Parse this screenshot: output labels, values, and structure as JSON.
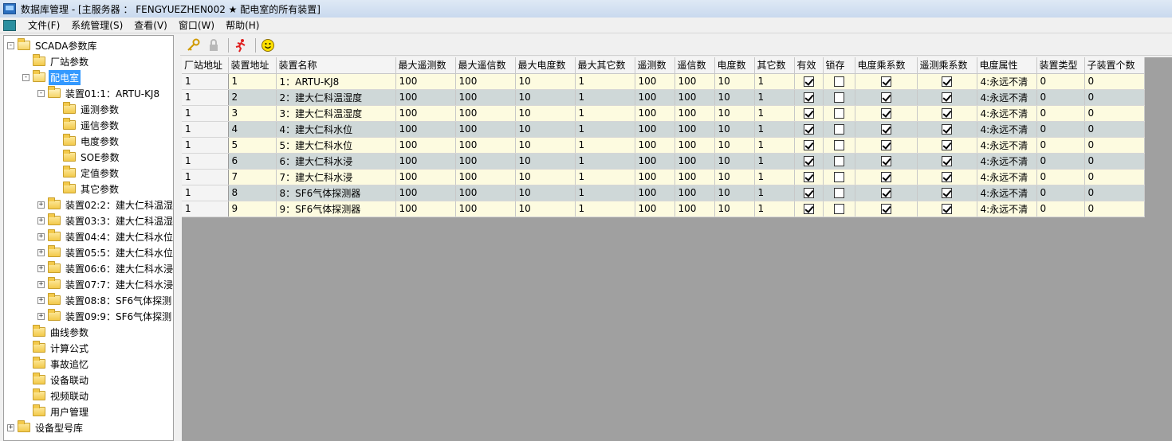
{
  "window": {
    "title": "数据库管理 - [主服务器 ： FENGYUEZHEN002 ★ 配电室的所有装置]"
  },
  "menu": [
    "文件(F)",
    "系统管理(S)",
    "查看(V)",
    "窗口(W)",
    "帮助(H)"
  ],
  "toolbar": {
    "icons": [
      "key-icon",
      "lock-icon",
      "running-man-icon",
      "smiley-icon"
    ]
  },
  "tree": [
    {
      "label": "SCADA参数库",
      "level": 0,
      "expander": "−",
      "open": true
    },
    {
      "label": "厂站参数",
      "level": 1
    },
    {
      "label": "配电室",
      "level": 1,
      "expander": "−",
      "open": true,
      "selected": true
    },
    {
      "label": "装置01:1：ARTU-KJ8",
      "level": 2,
      "expander": "−",
      "open": true
    },
    {
      "label": "遥测参数",
      "level": 3
    },
    {
      "label": "遥信参数",
      "level": 3
    },
    {
      "label": "电度参数",
      "level": 3
    },
    {
      "label": "SOE参数",
      "level": 3
    },
    {
      "label": "定值参数",
      "level": 3
    },
    {
      "label": "其它参数",
      "level": 3
    },
    {
      "label": "装置02:2：建大仁科温湿",
      "level": 2,
      "expander": "+"
    },
    {
      "label": "装置03:3：建大仁科温湿",
      "level": 2,
      "expander": "+"
    },
    {
      "label": "装置04:4：建大仁科水位",
      "level": 2,
      "expander": "+"
    },
    {
      "label": "装置05:5：建大仁科水位",
      "level": 2,
      "expander": "+"
    },
    {
      "label": "装置06:6：建大仁科水浸",
      "level": 2,
      "expander": "+"
    },
    {
      "label": "装置07:7：建大仁科水浸",
      "level": 2,
      "expander": "+"
    },
    {
      "label": "装置08:8：SF6气体探测",
      "level": 2,
      "expander": "+"
    },
    {
      "label": "装置09:9：SF6气体探测",
      "level": 2,
      "expander": "+"
    },
    {
      "label": "曲线参数",
      "level": 1
    },
    {
      "label": "计算公式",
      "level": 1
    },
    {
      "label": "事故追忆",
      "level": 1
    },
    {
      "label": "设备联动",
      "level": 1
    },
    {
      "label": "视频联动",
      "level": 1
    },
    {
      "label": "用户管理",
      "level": 1
    },
    {
      "label": "设备型号库",
      "level": 0,
      "expander": "+"
    }
  ],
  "grid": {
    "columns": [
      "厂站地址",
      "装置地址",
      "装置名称",
      "最大遥测数",
      "最大遥信数",
      "最大电度数",
      "最大其它数",
      "遥测数",
      "遥信数",
      "电度数",
      "其它数",
      "有效",
      "锁存",
      "电度乘系数",
      "遥测乘系数",
      "电度属性",
      "装置类型",
      "子装置个数"
    ],
    "rows": [
      [
        "1",
        "1",
        "1：ARTU-KJ8",
        "100",
        "100",
        "10",
        "1",
        "100",
        "100",
        "10",
        "1",
        true,
        false,
        true,
        true,
        "4:永远不清",
        "0",
        "0"
      ],
      [
        "1",
        "2",
        "2：建大仁科温湿度",
        "100",
        "100",
        "10",
        "1",
        "100",
        "100",
        "10",
        "1",
        true,
        false,
        true,
        true,
        "4:永远不清",
        "0",
        "0"
      ],
      [
        "1",
        "3",
        "3：建大仁科温湿度",
        "100",
        "100",
        "10",
        "1",
        "100",
        "100",
        "10",
        "1",
        true,
        false,
        true,
        true,
        "4:永远不清",
        "0",
        "0"
      ],
      [
        "1",
        "4",
        "4：建大仁科水位",
        "100",
        "100",
        "10",
        "1",
        "100",
        "100",
        "10",
        "1",
        true,
        false,
        true,
        true,
        "4:永远不清",
        "0",
        "0"
      ],
      [
        "1",
        "5",
        "5：建大仁科水位",
        "100",
        "100",
        "10",
        "1",
        "100",
        "100",
        "10",
        "1",
        true,
        false,
        true,
        true,
        "4:永远不清",
        "0",
        "0"
      ],
      [
        "1",
        "6",
        "6：建大仁科水浸",
        "100",
        "100",
        "10",
        "1",
        "100",
        "100",
        "10",
        "1",
        true,
        false,
        true,
        true,
        "4:永远不清",
        "0",
        "0"
      ],
      [
        "1",
        "7",
        "7：建大仁科水浸",
        "100",
        "100",
        "10",
        "1",
        "100",
        "100",
        "10",
        "1",
        true,
        false,
        true,
        true,
        "4:永远不清",
        "0",
        "0"
      ],
      [
        "1",
        "8",
        "8：SF6气体探测器",
        "100",
        "100",
        "10",
        "1",
        "100",
        "100",
        "10",
        "1",
        true,
        false,
        true,
        true,
        "4:永远不清",
        "0",
        "0"
      ],
      [
        "1",
        "9",
        "9：SF6气体探测器",
        "100",
        "100",
        "10",
        "1",
        "100",
        "100",
        "10",
        "1",
        true,
        false,
        true,
        true,
        "4:永远不清",
        "0",
        "0"
      ]
    ]
  },
  "colors": {
    "selection": "#3399ff",
    "row_odd": "#fdfbe0",
    "row_even": "#cfd8d8",
    "grid_bg": "#a0a0a0"
  }
}
